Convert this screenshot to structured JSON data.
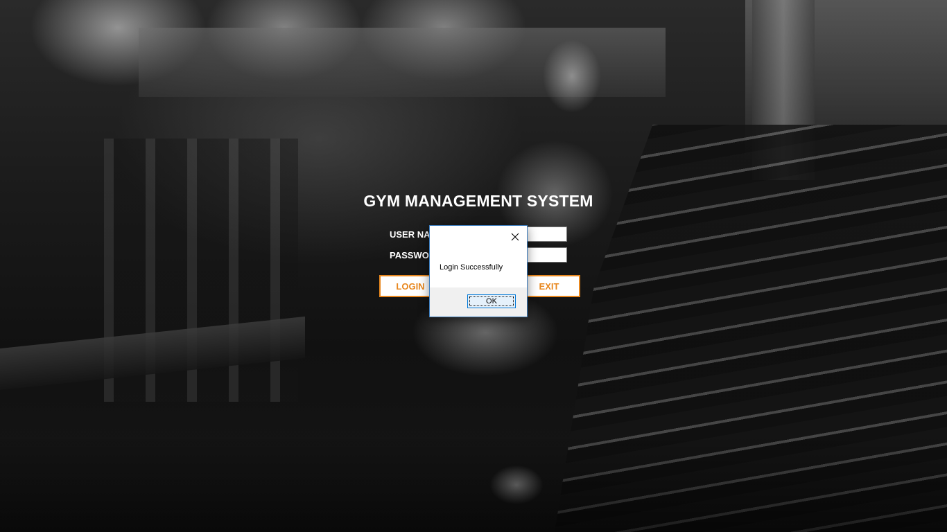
{
  "app": {
    "title": "GYM MANAGEMENT SYSTEM",
    "username_label": "USER NAME",
    "password_label": "PASSWORD",
    "username_value": "",
    "password_value": "",
    "login_label": "LOGIN",
    "exit_label": "EXIT"
  },
  "dialog": {
    "message": "Login Successfully",
    "ok_label": "OK",
    "close_icon": "close-icon"
  },
  "colors": {
    "accent": "#e8871e",
    "dialog_border": "#3d7dbd",
    "ok_border": "#0078d7"
  }
}
